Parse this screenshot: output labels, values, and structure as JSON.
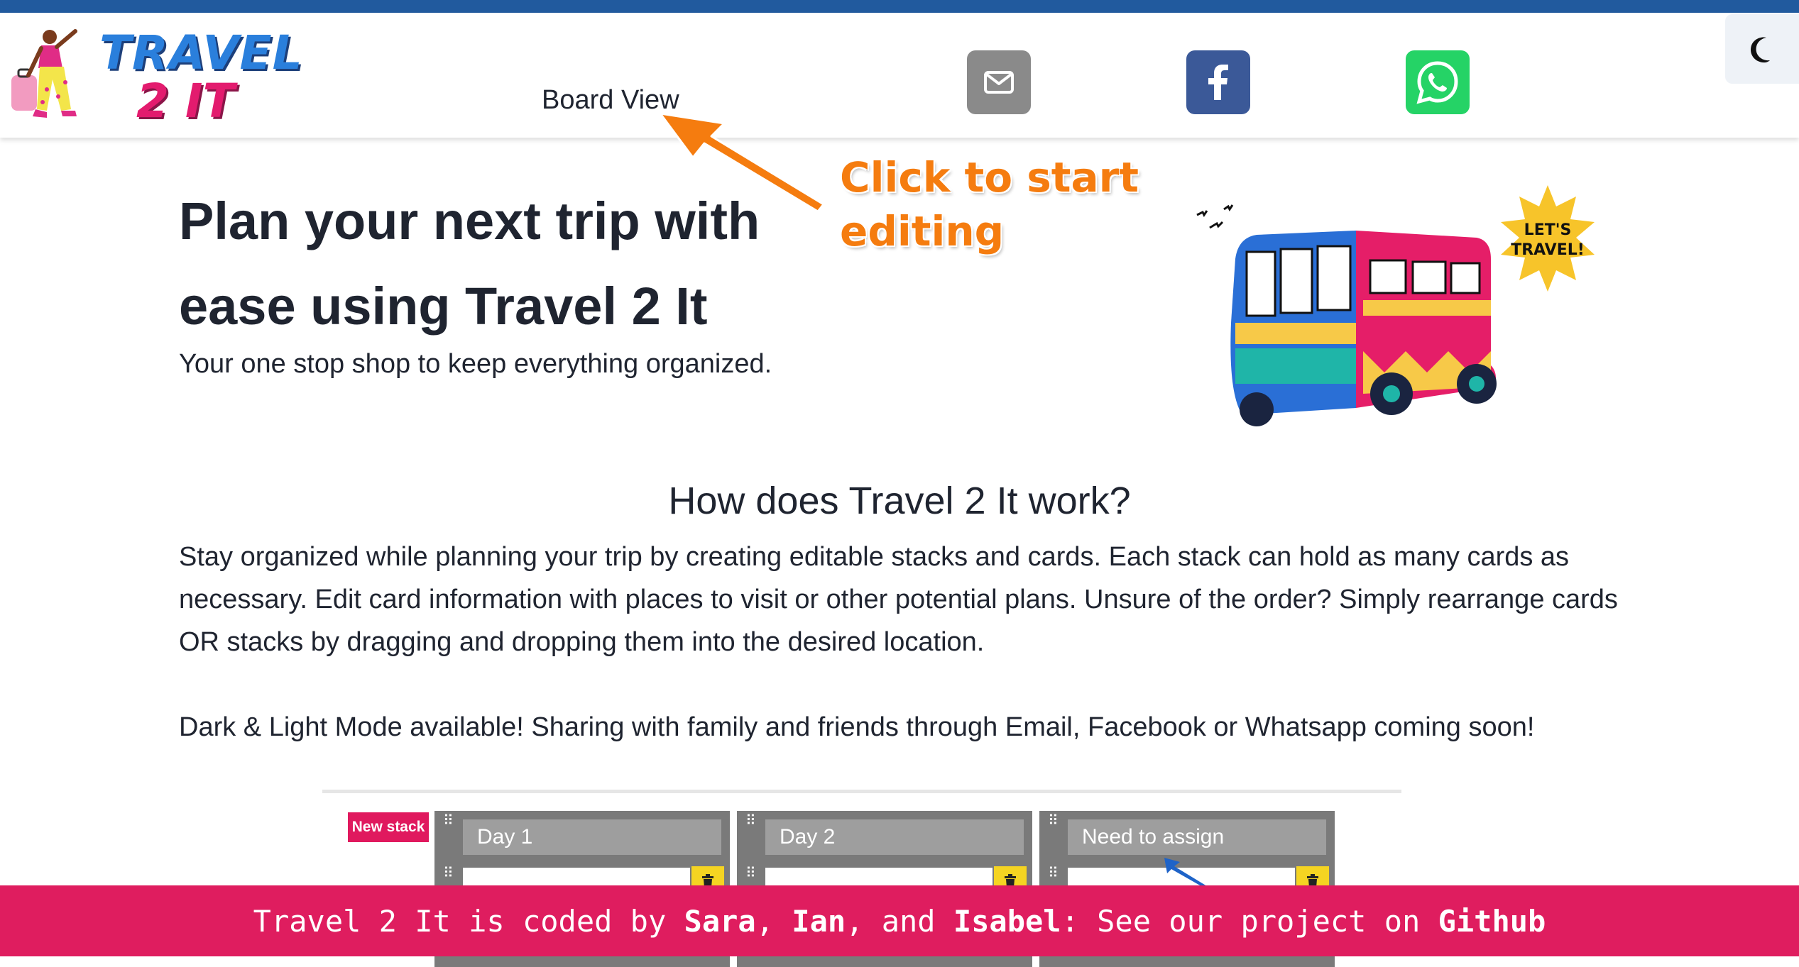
{
  "header": {
    "logo": {
      "line1": "TRAVEL",
      "line2": "2 IT"
    },
    "nav_link": "Board View",
    "social": [
      "mail-icon",
      "facebook-icon",
      "whatsapp-icon"
    ],
    "theme_toggle_icon": "moon-icon"
  },
  "annotation": {
    "line1": "Click to start",
    "line2": "editing",
    "color": "#f57c0f"
  },
  "hero": {
    "title": "Plan your next trip with ease using Travel 2 It",
    "subtitle": "Your one stop shop to keep everything organized.",
    "badge": {
      "line1": "LET'S",
      "line2": "TRAVEL!"
    }
  },
  "how": {
    "title": "How does Travel 2 It work?",
    "body": "Stay organized while planning your trip by creating editable stacks and cards. Each stack can hold as many cards as necessary. Edit card information with places to visit or other potential plans. Unsure of the order? Simply rearrange cards OR stacks by dragging and dropping them into the desired location.",
    "body2": "Dark & Light Mode available! Sharing with family and friends through Email, Facebook or Whatsapp coming soon!"
  },
  "board_preview": {
    "new_stack_label": "New stack",
    "stacks": [
      {
        "title": "Day 1"
      },
      {
        "title": "Day 2"
      },
      {
        "title": "Need to assign"
      }
    ]
  },
  "footer": {
    "prefix": "Travel 2 It is coded by ",
    "name1": "Sara",
    "sep1": ", ",
    "name2": "Ian",
    "sep2": ", and ",
    "name3": "Isabel",
    "mid": ": See our project on ",
    "link": "Github"
  },
  "colors": {
    "topbar": "#215a9e",
    "accent_pink": "#df1d5f",
    "facebook": "#3b5998",
    "whatsapp": "#25d366"
  }
}
